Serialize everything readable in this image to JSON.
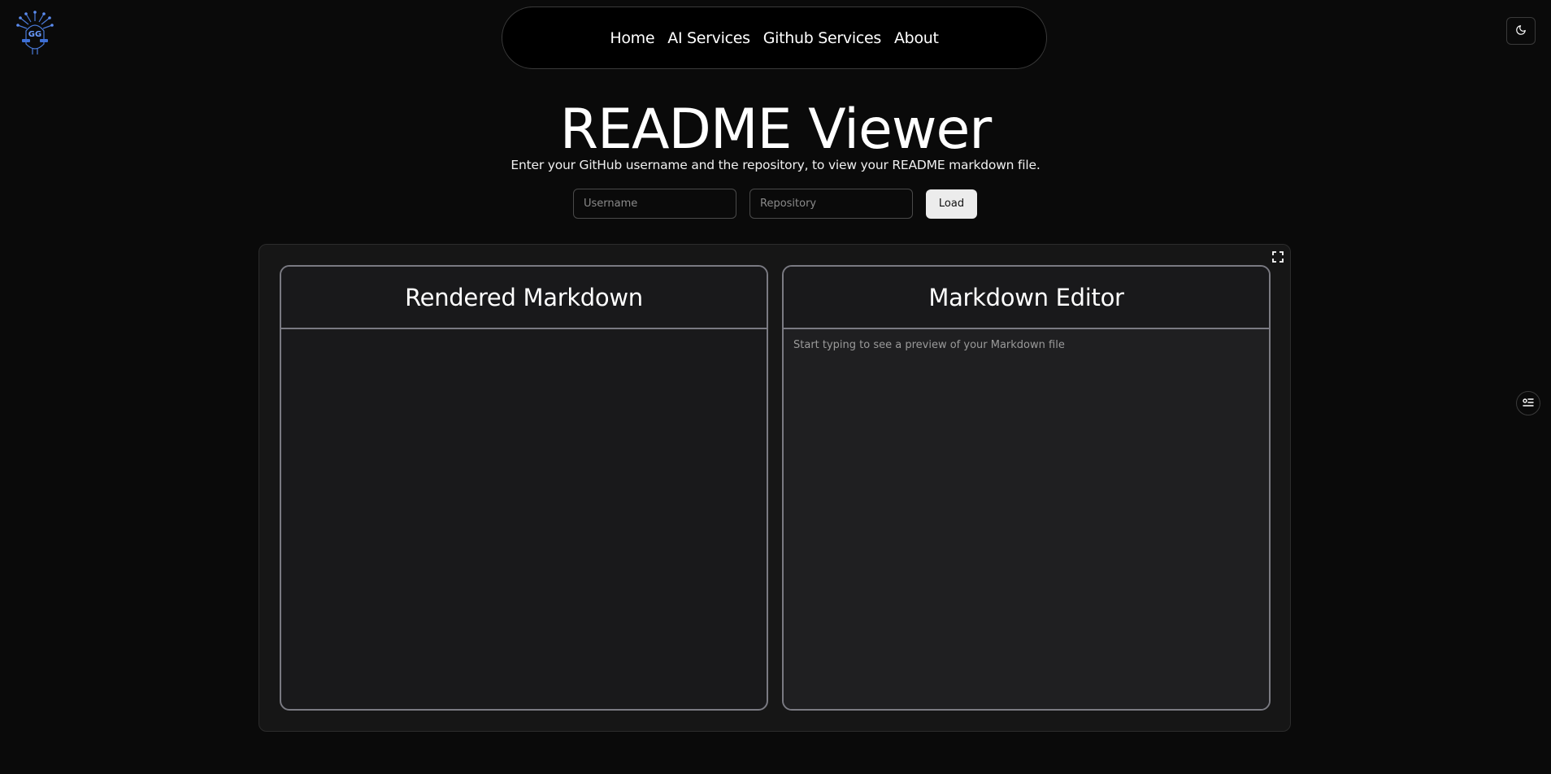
{
  "logo": {
    "icon": "gg-logo-icon",
    "text": "GG"
  },
  "nav": {
    "links": [
      "Home",
      "AI Services",
      "Github Services",
      "About"
    ]
  },
  "theme_toggle": {
    "icon": "moon-icon"
  },
  "header": {
    "title": "README Viewer",
    "subtitle": "Enter your GitHub username and the repository, to view your README markdown file."
  },
  "form": {
    "username_placeholder": "Username",
    "username_value": "",
    "repository_placeholder": "Repository",
    "repository_value": "",
    "load_label": "Load"
  },
  "panels": {
    "rendered_title": "Rendered Markdown",
    "editor_title": "Markdown Editor",
    "editor_placeholder": "Start typing to see a preview of your Markdown file",
    "editor_value": ""
  },
  "icons": {
    "fullscreen": "fullscreen-icon",
    "side_tool": "settings-list-icon"
  },
  "colors": {
    "background": "#0a0a0a",
    "panel_border": "#7a7a82",
    "load_button": "#ececec"
  }
}
